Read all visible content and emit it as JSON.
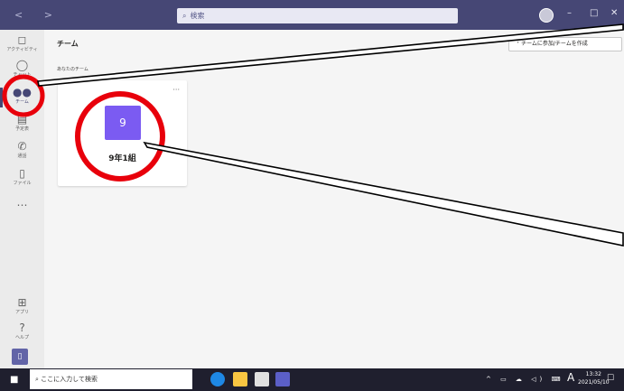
{
  "window": {
    "nav_arrows": "< >",
    "search_placeholder": "検索",
    "controls": {
      "minimize": "–",
      "maximize": "□",
      "close": "✕"
    }
  },
  "rail": {
    "items": [
      {
        "label": "アクティビティ",
        "icon": "bell-icon",
        "glyph": "🔔"
      },
      {
        "label": "チャット",
        "icon": "chat-icon",
        "glyph": "💬"
      },
      {
        "label": "チーム",
        "icon": "teams-icon",
        "glyph": "👥"
      },
      {
        "label": "予定表",
        "icon": "calendar-icon",
        "glyph": "▤"
      },
      {
        "label": "通話",
        "icon": "phone-icon",
        "glyph": "📞"
      },
      {
        "label": "ファイル",
        "icon": "file-icon",
        "glyph": "🗋"
      },
      {
        "label": "…",
        "icon": "more-icon",
        "glyph": ""
      }
    ],
    "bottom_items": [
      {
        "label": "アプリ",
        "icon": "apps-icon",
        "glyph": "⊞"
      },
      {
        "label": "ヘルプ",
        "icon": "help-icon",
        "glyph": "?"
      }
    ],
    "device_icon": "▯"
  },
  "main": {
    "title": "チーム",
    "join_button": "チームに参加/チームを作成",
    "section_label": "あなたのチーム",
    "team": {
      "initial": "9",
      "name": "9年1組",
      "more": "···"
    }
  },
  "taskbar": {
    "search_placeholder": "ここに入力して検索",
    "tray": "^ ▭ ☁ ◁) ⌨",
    "ime": "A",
    "time": "13:32",
    "date": "2021/05/10",
    "notification": "☐"
  },
  "colors": {
    "teams_purple": "#464775",
    "team_tile": "#7b5bf2",
    "annotation_red": "#e8000b"
  }
}
